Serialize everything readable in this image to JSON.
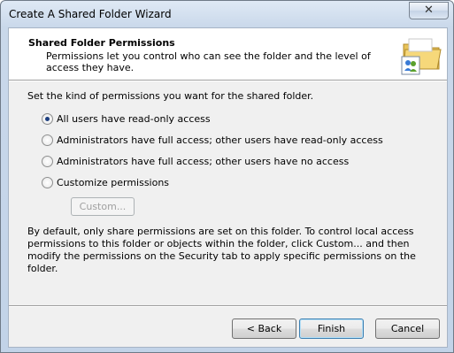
{
  "window": {
    "title": "Create A Shared Folder Wizard",
    "close_glyph": "✕"
  },
  "header": {
    "title": "Shared Folder Permissions",
    "description": "Permissions let you control who can see the folder and the level of access they have.",
    "icon": "shared-folder-users-icon"
  },
  "body": {
    "instruction": "Set the kind of permissions you want for the shared folder.",
    "options": [
      {
        "label": "All users have read-only access",
        "checked": true
      },
      {
        "label": "Administrators have full access; other users have read-only access",
        "checked": false
      },
      {
        "label": "Administrators have full access; other users have no access",
        "checked": false
      },
      {
        "label": "Customize permissions",
        "checked": false
      }
    ],
    "custom_button": "Custom...",
    "custom_button_enabled": false,
    "note": "By default, only share permissions are set on this folder. To control local access permissions to this folder or objects within the folder, click Custom... and then modify the permissions on the Security tab to apply specific permissions on the folder."
  },
  "footer": {
    "back": "< Back",
    "finish": "Finish",
    "cancel": "Cancel"
  }
}
